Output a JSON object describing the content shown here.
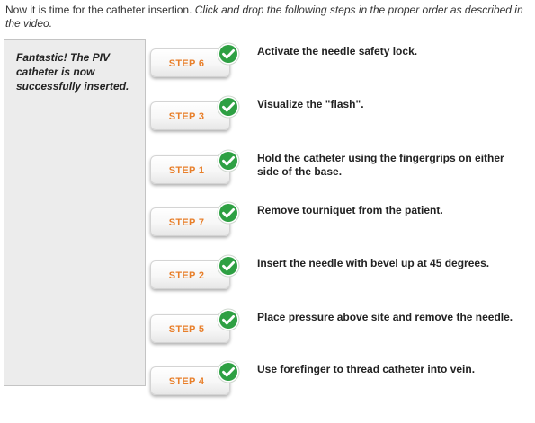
{
  "instructions": {
    "plain": "Now it is time for the catheter insertion. ",
    "italic": "Click and drop the following steps in the proper order as described in the video."
  },
  "feedback": {
    "text": "Fantastic! The PIV catheter is now successfully inserted."
  },
  "colors": {
    "step_label": "#e87f2a",
    "check_green": "#2ea043",
    "panel_bg": "#ececec"
  },
  "steps": [
    {
      "label": "STEP 6",
      "status": "correct-check-icon",
      "description": "Activate the needle safety lock."
    },
    {
      "label": "STEP 3",
      "status": "correct-check-icon",
      "description": "Visualize the \"flash\"."
    },
    {
      "label": "STEP 1",
      "status": "correct-check-icon",
      "description": "Hold the catheter using the fingergrips on either side of the base."
    },
    {
      "label": "STEP 7",
      "status": "correct-check-icon",
      "description": "Remove tourniquet from the patient."
    },
    {
      "label": "STEP 2",
      "status": "correct-check-icon",
      "description": "Insert the needle with bevel up at 45 degrees."
    },
    {
      "label": "STEP 5",
      "status": "correct-check-icon",
      "description": "Place pressure above site and remove the needle."
    },
    {
      "label": "STEP 4",
      "status": "correct-check-icon",
      "description": "Use forefinger to thread catheter into vein."
    }
  ]
}
